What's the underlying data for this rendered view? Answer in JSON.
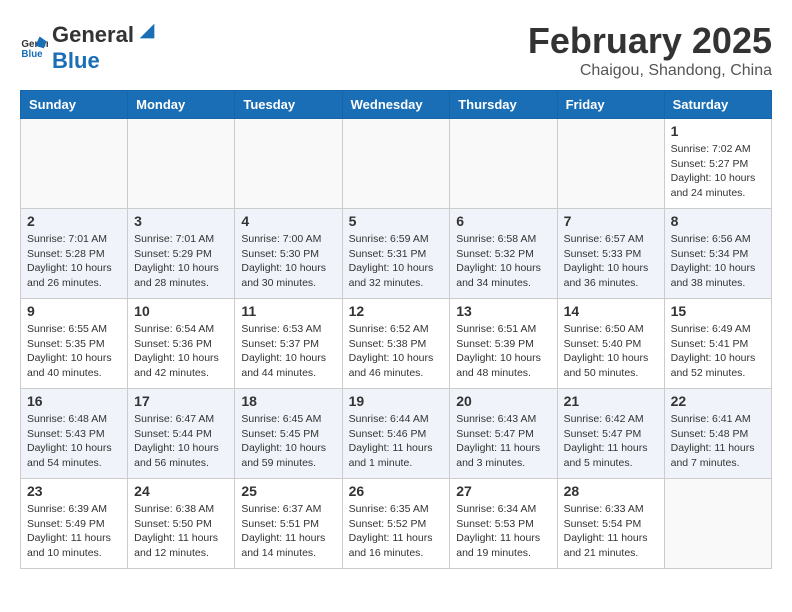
{
  "header": {
    "logo_general": "General",
    "logo_blue": "Blue",
    "month_title": "February 2025",
    "subtitle": "Chaigou, Shandong, China"
  },
  "weekdays": [
    "Sunday",
    "Monday",
    "Tuesday",
    "Wednesday",
    "Thursday",
    "Friday",
    "Saturday"
  ],
  "weeks": [
    [
      {
        "day": "",
        "info": ""
      },
      {
        "day": "",
        "info": ""
      },
      {
        "day": "",
        "info": ""
      },
      {
        "day": "",
        "info": ""
      },
      {
        "day": "",
        "info": ""
      },
      {
        "day": "",
        "info": ""
      },
      {
        "day": "1",
        "info": "Sunrise: 7:02 AM\nSunset: 5:27 PM\nDaylight: 10 hours and 24 minutes."
      }
    ],
    [
      {
        "day": "2",
        "info": "Sunrise: 7:01 AM\nSunset: 5:28 PM\nDaylight: 10 hours and 26 minutes."
      },
      {
        "day": "3",
        "info": "Sunrise: 7:01 AM\nSunset: 5:29 PM\nDaylight: 10 hours and 28 minutes."
      },
      {
        "day": "4",
        "info": "Sunrise: 7:00 AM\nSunset: 5:30 PM\nDaylight: 10 hours and 30 minutes."
      },
      {
        "day": "5",
        "info": "Sunrise: 6:59 AM\nSunset: 5:31 PM\nDaylight: 10 hours and 32 minutes."
      },
      {
        "day": "6",
        "info": "Sunrise: 6:58 AM\nSunset: 5:32 PM\nDaylight: 10 hours and 34 minutes."
      },
      {
        "day": "7",
        "info": "Sunrise: 6:57 AM\nSunset: 5:33 PM\nDaylight: 10 hours and 36 minutes."
      },
      {
        "day": "8",
        "info": "Sunrise: 6:56 AM\nSunset: 5:34 PM\nDaylight: 10 hours and 38 minutes."
      }
    ],
    [
      {
        "day": "9",
        "info": "Sunrise: 6:55 AM\nSunset: 5:35 PM\nDaylight: 10 hours and 40 minutes."
      },
      {
        "day": "10",
        "info": "Sunrise: 6:54 AM\nSunset: 5:36 PM\nDaylight: 10 hours and 42 minutes."
      },
      {
        "day": "11",
        "info": "Sunrise: 6:53 AM\nSunset: 5:37 PM\nDaylight: 10 hours and 44 minutes."
      },
      {
        "day": "12",
        "info": "Sunrise: 6:52 AM\nSunset: 5:38 PM\nDaylight: 10 hours and 46 minutes."
      },
      {
        "day": "13",
        "info": "Sunrise: 6:51 AM\nSunset: 5:39 PM\nDaylight: 10 hours and 48 minutes."
      },
      {
        "day": "14",
        "info": "Sunrise: 6:50 AM\nSunset: 5:40 PM\nDaylight: 10 hours and 50 minutes."
      },
      {
        "day": "15",
        "info": "Sunrise: 6:49 AM\nSunset: 5:41 PM\nDaylight: 10 hours and 52 minutes."
      }
    ],
    [
      {
        "day": "16",
        "info": "Sunrise: 6:48 AM\nSunset: 5:43 PM\nDaylight: 10 hours and 54 minutes."
      },
      {
        "day": "17",
        "info": "Sunrise: 6:47 AM\nSunset: 5:44 PM\nDaylight: 10 hours and 56 minutes."
      },
      {
        "day": "18",
        "info": "Sunrise: 6:45 AM\nSunset: 5:45 PM\nDaylight: 10 hours and 59 minutes."
      },
      {
        "day": "19",
        "info": "Sunrise: 6:44 AM\nSunset: 5:46 PM\nDaylight: 11 hours and 1 minute."
      },
      {
        "day": "20",
        "info": "Sunrise: 6:43 AM\nSunset: 5:47 PM\nDaylight: 11 hours and 3 minutes."
      },
      {
        "day": "21",
        "info": "Sunrise: 6:42 AM\nSunset: 5:47 PM\nDaylight: 11 hours and 5 minutes."
      },
      {
        "day": "22",
        "info": "Sunrise: 6:41 AM\nSunset: 5:48 PM\nDaylight: 11 hours and 7 minutes."
      }
    ],
    [
      {
        "day": "23",
        "info": "Sunrise: 6:39 AM\nSunset: 5:49 PM\nDaylight: 11 hours and 10 minutes."
      },
      {
        "day": "24",
        "info": "Sunrise: 6:38 AM\nSunset: 5:50 PM\nDaylight: 11 hours and 12 minutes."
      },
      {
        "day": "25",
        "info": "Sunrise: 6:37 AM\nSunset: 5:51 PM\nDaylight: 11 hours and 14 minutes."
      },
      {
        "day": "26",
        "info": "Sunrise: 6:35 AM\nSunset: 5:52 PM\nDaylight: 11 hours and 16 minutes."
      },
      {
        "day": "27",
        "info": "Sunrise: 6:34 AM\nSunset: 5:53 PM\nDaylight: 11 hours and 19 minutes."
      },
      {
        "day": "28",
        "info": "Sunrise: 6:33 AM\nSunset: 5:54 PM\nDaylight: 11 hours and 21 minutes."
      },
      {
        "day": "",
        "info": ""
      }
    ]
  ]
}
